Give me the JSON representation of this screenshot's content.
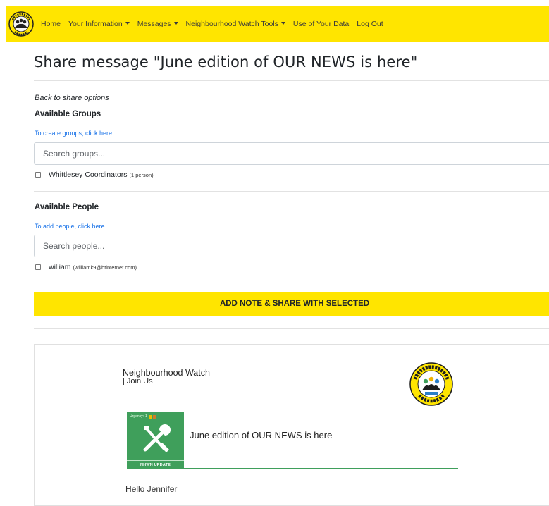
{
  "nav": {
    "home": "Home",
    "your_information": "Your Information",
    "messages": "Messages",
    "tools": "Neighbourhood Watch Tools",
    "use_of_data": "Use of Your Data",
    "log_out": "Log Out"
  },
  "page": {
    "title": "Share message \"June edition of OUR NEWS is here\"",
    "back_link": "Back to share options"
  },
  "groups": {
    "heading": "Available Groups",
    "create_link": "To create groups, click here",
    "search_placeholder": "Search groups...",
    "items": [
      {
        "label": "Whittlesey Coordinators",
        "sub": "(1 person)",
        "checked": false
      }
    ]
  },
  "people": {
    "heading": "Available People",
    "add_link": "To add people, click here",
    "search_placeholder": "Search people...",
    "items": [
      {
        "label": "william",
        "sub": "(williamk9@btinternet.com)",
        "checked": false
      }
    ]
  },
  "share_button": "ADD NOTE & SHARE WITH SELECTED",
  "preview": {
    "brand": "Neighbourhood Watch",
    "join": "| Join Us",
    "urgency_label": "Urgency:",
    "urgency_level": "1",
    "tile_footer": "NHWN UPDATE",
    "message_title": "June edition of OUR NEWS is here",
    "greeting": "Hello Jennifer"
  },
  "colors": {
    "brand_yellow": "#ffe500",
    "link_blue": "#1a73e8",
    "nhw_green": "#3f9f5b"
  }
}
